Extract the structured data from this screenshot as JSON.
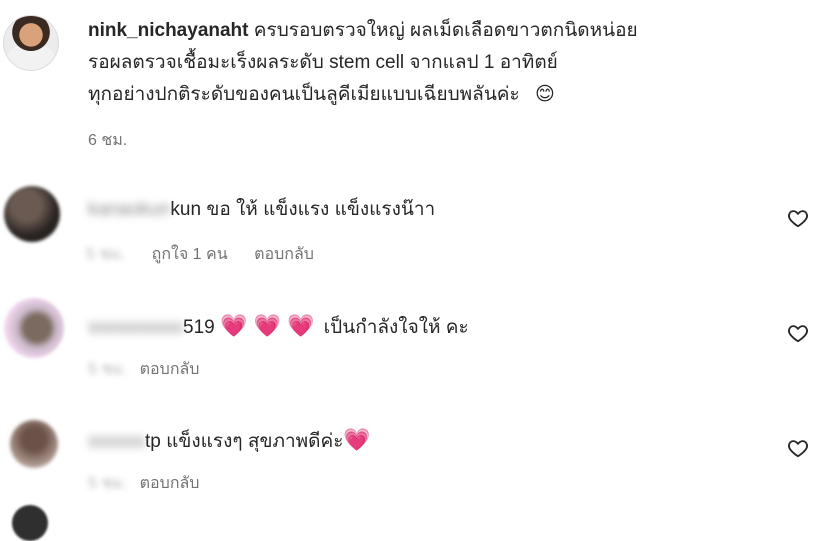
{
  "post": {
    "username": "nink_nichayanaht",
    "lines": [
      "ครบรอบตรวจใหญ่ ผลเม็ดเลือดขาวตกนิดหน่อย",
      "รอผลตรวจเชื้อมะเร็งผลระดับ stem cell จากแลป 1 อาทิตย์",
      "ทุกอย่างปกติระดับของคนเป็นลูคีเมียแบบเฉียบพลันค่ะ"
    ],
    "emoji": "😊",
    "time": "6 ชม."
  },
  "comments": [
    {
      "username_hidden": "kanaokun",
      "username_visible": "kun",
      "text": "ขอ ให้ แข็งแรง แข็งแรงน๊าา",
      "time": "5 ชม.",
      "likes": "ถูกใจ 1 คน",
      "reply": "ตอบกลับ"
    },
    {
      "username_hidden": "ssssssssss",
      "username_visible": "519",
      "hearts": "💗 💗 💗",
      "text": "เป็นกำลังใจให้ คะ",
      "time": "5 ชม.",
      "reply": "ตอบกลับ"
    },
    {
      "username_hidden": "ssssss",
      "username_visible": "tp",
      "text": "แข็งแรงๆ สุขภาพดีค่ะ",
      "heart_emoji": "💗",
      "time": "5 ชม.",
      "reply": "ตอบกลับ"
    }
  ],
  "icons": {
    "like": "heart-outline-icon"
  }
}
